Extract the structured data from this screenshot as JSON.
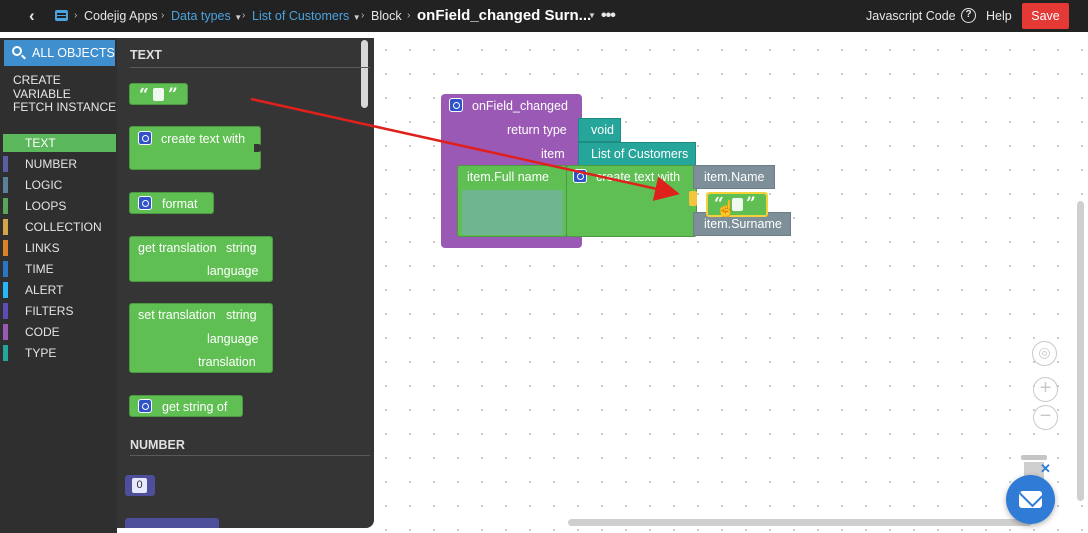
{
  "topbar": {
    "back_icon": "chevron-left-icon",
    "app_icon": "app-list-icon",
    "app_name": "Codejig Apps",
    "crumbs": [
      "Data types",
      "List of Customers",
      "Block"
    ],
    "current": "onField_changed Surn...",
    "more_icon": "more-dots-icon",
    "right_link": "Javascript Code",
    "help_label": "Help",
    "help_glyph": "?",
    "save_label": "Save",
    "colors": {
      "bar": "#222222",
      "link": "#4aa3df",
      "save": "#e53935"
    }
  },
  "sidebar": {
    "all_objects": "ALL OBJECTS",
    "actions": [
      "CREATE VARIABLE",
      "FETCH INSTANCE"
    ],
    "categories": [
      {
        "label": "TEXT",
        "color": "#5cb85c"
      },
      {
        "label": "NUMBER",
        "color": "#5b5ea6"
      },
      {
        "label": "LOGIC",
        "color": "#5b8199"
      },
      {
        "label": "LOOPS",
        "color": "#5ba55b"
      },
      {
        "label": "COLLECTION",
        "color": "#d4a64a"
      },
      {
        "label": "LINKS",
        "color": "#d9822b"
      },
      {
        "label": "TIME",
        "color": "#2a76c6"
      },
      {
        "label": "ALERT",
        "color": "#29b6f6"
      },
      {
        "label": "FILTERS",
        "color": "#5f4bb6"
      },
      {
        "label": "CODE",
        "color": "#9b59b6"
      },
      {
        "label": "TYPE",
        "color": "#26a69a"
      }
    ],
    "active": "TEXT"
  },
  "flyout": {
    "section_text": "TEXT",
    "section_number": "NUMBER",
    "blocks": {
      "create_text_with": "create text with",
      "format": "format",
      "get_translation": "get translation",
      "get_translation_string": "string",
      "get_translation_language": "language",
      "set_translation": "set translation",
      "set_translation_string": "string",
      "set_translation_language": "language",
      "set_translation_translation": "translation",
      "get_string_of": "get string of",
      "number_value": "0"
    }
  },
  "workspace": {
    "event_block": "onField_changed",
    "return_type_label": "return type",
    "return_type_value": "void",
    "item_label": "item",
    "item_value": "List of Customers",
    "field_label": "item.Full name",
    "create_text_with": "create text with",
    "input_1": "item.Name",
    "input_2": "item.Surname",
    "zoom_in": "+",
    "zoom_out": "−"
  }
}
